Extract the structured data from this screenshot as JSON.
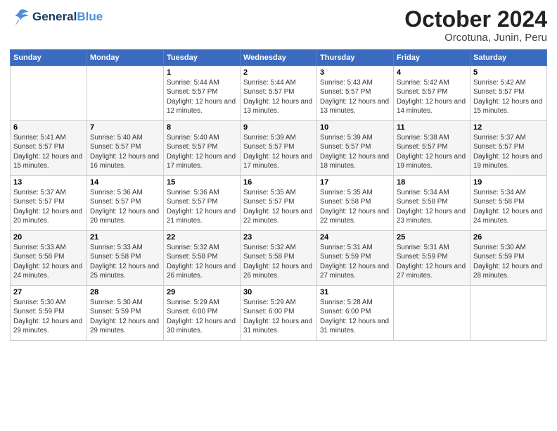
{
  "header": {
    "logo_line1": "General",
    "logo_line2": "Blue",
    "title": "October 2024",
    "subtitle": "Orcotuna, Junin, Peru"
  },
  "weekdays": [
    "Sunday",
    "Monday",
    "Tuesday",
    "Wednesday",
    "Thursday",
    "Friday",
    "Saturday"
  ],
  "weeks": [
    [
      {
        "day": "",
        "info": ""
      },
      {
        "day": "",
        "info": ""
      },
      {
        "day": "1",
        "info": "Sunrise: 5:44 AM\nSunset: 5:57 PM\nDaylight: 12 hours and 12 minutes."
      },
      {
        "day": "2",
        "info": "Sunrise: 5:44 AM\nSunset: 5:57 PM\nDaylight: 12 hours and 13 minutes."
      },
      {
        "day": "3",
        "info": "Sunrise: 5:43 AM\nSunset: 5:57 PM\nDaylight: 12 hours and 13 minutes."
      },
      {
        "day": "4",
        "info": "Sunrise: 5:42 AM\nSunset: 5:57 PM\nDaylight: 12 hours and 14 minutes."
      },
      {
        "day": "5",
        "info": "Sunrise: 5:42 AM\nSunset: 5:57 PM\nDaylight: 12 hours and 15 minutes."
      }
    ],
    [
      {
        "day": "6",
        "info": "Sunrise: 5:41 AM\nSunset: 5:57 PM\nDaylight: 12 hours and 15 minutes."
      },
      {
        "day": "7",
        "info": "Sunrise: 5:40 AM\nSunset: 5:57 PM\nDaylight: 12 hours and 16 minutes."
      },
      {
        "day": "8",
        "info": "Sunrise: 5:40 AM\nSunset: 5:57 PM\nDaylight: 12 hours and 17 minutes."
      },
      {
        "day": "9",
        "info": "Sunrise: 5:39 AM\nSunset: 5:57 PM\nDaylight: 12 hours and 17 minutes."
      },
      {
        "day": "10",
        "info": "Sunrise: 5:39 AM\nSunset: 5:57 PM\nDaylight: 12 hours and 18 minutes."
      },
      {
        "day": "11",
        "info": "Sunrise: 5:38 AM\nSunset: 5:57 PM\nDaylight: 12 hours and 19 minutes."
      },
      {
        "day": "12",
        "info": "Sunrise: 5:37 AM\nSunset: 5:57 PM\nDaylight: 12 hours and 19 minutes."
      }
    ],
    [
      {
        "day": "13",
        "info": "Sunrise: 5:37 AM\nSunset: 5:57 PM\nDaylight: 12 hours and 20 minutes."
      },
      {
        "day": "14",
        "info": "Sunrise: 5:36 AM\nSunset: 5:57 PM\nDaylight: 12 hours and 20 minutes."
      },
      {
        "day": "15",
        "info": "Sunrise: 5:36 AM\nSunset: 5:57 PM\nDaylight: 12 hours and 21 minutes."
      },
      {
        "day": "16",
        "info": "Sunrise: 5:35 AM\nSunset: 5:57 PM\nDaylight: 12 hours and 22 minutes."
      },
      {
        "day": "17",
        "info": "Sunrise: 5:35 AM\nSunset: 5:58 PM\nDaylight: 12 hours and 22 minutes."
      },
      {
        "day": "18",
        "info": "Sunrise: 5:34 AM\nSunset: 5:58 PM\nDaylight: 12 hours and 23 minutes."
      },
      {
        "day": "19",
        "info": "Sunrise: 5:34 AM\nSunset: 5:58 PM\nDaylight: 12 hours and 24 minutes."
      }
    ],
    [
      {
        "day": "20",
        "info": "Sunrise: 5:33 AM\nSunset: 5:58 PM\nDaylight: 12 hours and 24 minutes."
      },
      {
        "day": "21",
        "info": "Sunrise: 5:33 AM\nSunset: 5:58 PM\nDaylight: 12 hours and 25 minutes."
      },
      {
        "day": "22",
        "info": "Sunrise: 5:32 AM\nSunset: 5:58 PM\nDaylight: 12 hours and 26 minutes."
      },
      {
        "day": "23",
        "info": "Sunrise: 5:32 AM\nSunset: 5:58 PM\nDaylight: 12 hours and 26 minutes."
      },
      {
        "day": "24",
        "info": "Sunrise: 5:31 AM\nSunset: 5:59 PM\nDaylight: 12 hours and 27 minutes."
      },
      {
        "day": "25",
        "info": "Sunrise: 5:31 AM\nSunset: 5:59 PM\nDaylight: 12 hours and 27 minutes."
      },
      {
        "day": "26",
        "info": "Sunrise: 5:30 AM\nSunset: 5:59 PM\nDaylight: 12 hours and 28 minutes."
      }
    ],
    [
      {
        "day": "27",
        "info": "Sunrise: 5:30 AM\nSunset: 5:59 PM\nDaylight: 12 hours and 29 minutes."
      },
      {
        "day": "28",
        "info": "Sunrise: 5:30 AM\nSunset: 5:59 PM\nDaylight: 12 hours and 29 minutes."
      },
      {
        "day": "29",
        "info": "Sunrise: 5:29 AM\nSunset: 6:00 PM\nDaylight: 12 hours and 30 minutes."
      },
      {
        "day": "30",
        "info": "Sunrise: 5:29 AM\nSunset: 6:00 PM\nDaylight: 12 hours and 31 minutes."
      },
      {
        "day": "31",
        "info": "Sunrise: 5:28 AM\nSunset: 6:00 PM\nDaylight: 12 hours and 31 minutes."
      },
      {
        "day": "",
        "info": ""
      },
      {
        "day": "",
        "info": ""
      }
    ]
  ]
}
